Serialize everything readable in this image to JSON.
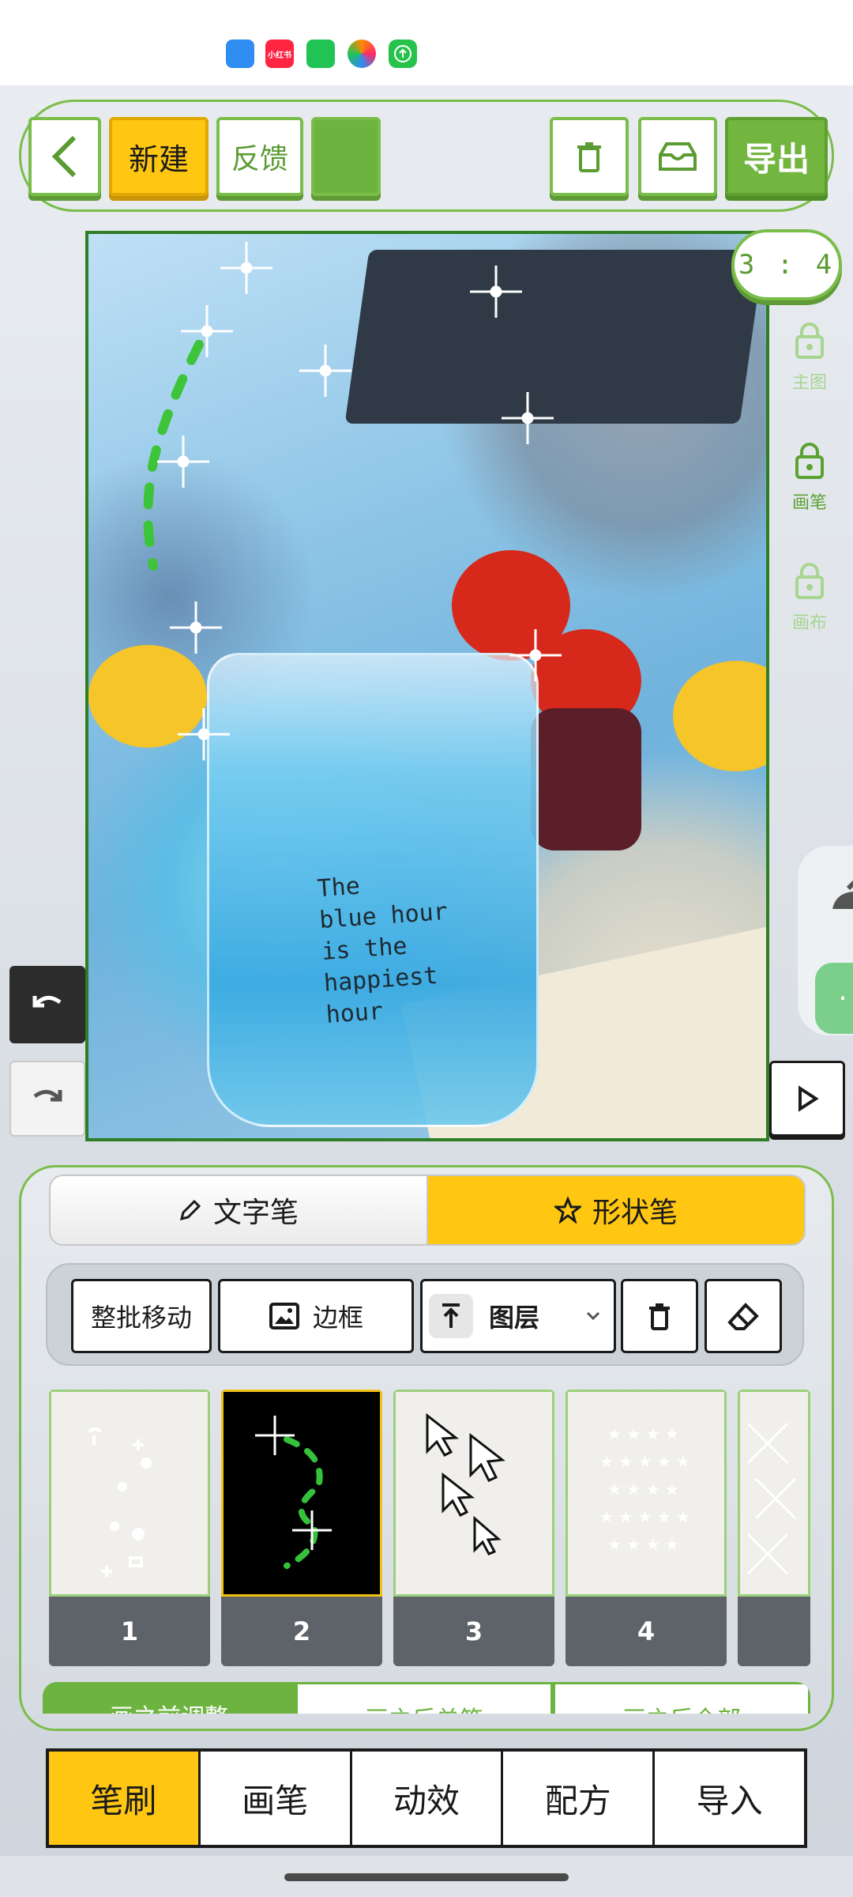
{
  "status_bar": {
    "apps": [
      {
        "name": "wallet",
        "color": "#2f8cf0",
        "label": ""
      },
      {
        "name": "xiaohongshu",
        "color": "#ff2442",
        "label": "小红书"
      },
      {
        "name": "app-green",
        "color": "#21c355",
        "label": ""
      },
      {
        "name": "app-colorful",
        "color": "#ff8a00",
        "label": ""
      },
      {
        "name": "app-upload",
        "color": "#27c24c",
        "label": ""
      }
    ]
  },
  "toolbar": {
    "back_icon": "chevron-left-icon",
    "new_label": "新建",
    "feedback_label": "反馈",
    "color_swatch": "#6db33f",
    "delete_icon": "trash-icon",
    "inbox_icon": "tray-icon",
    "export_label": "导出"
  },
  "canvas": {
    "ratio": "3 : 4",
    "cup_text": [
      "The",
      "blue hour",
      "is the",
      "happiest",
      "hour"
    ]
  },
  "side_panel": {
    "items": [
      {
        "label": "主图",
        "icon": "lock-icon",
        "active": false
      },
      {
        "label": "画笔",
        "icon": "lock-icon",
        "active": true
      },
      {
        "label": "画布",
        "icon": "lock-icon",
        "active": false
      }
    ]
  },
  "pen_tabs": {
    "text_pen": "文字笔",
    "shape_pen": "形状笔",
    "active": "shape_pen"
  },
  "tools": {
    "batch_move": "整批移动",
    "border": "边框",
    "layer": "图层"
  },
  "brush_cards": [
    {
      "number": "1"
    },
    {
      "number": "2",
      "selected": true
    },
    {
      "number": "3"
    },
    {
      "number": "4"
    },
    {
      "number": ""
    }
  ],
  "sub_tabs": [
    "画之前调整",
    "画之后单笔",
    "画之后全部"
  ],
  "bottom_nav": {
    "items": [
      "笔刷",
      "画笔",
      "动效",
      "配方",
      "导入"
    ],
    "active": 0
  },
  "colors": {
    "accent_green": "#7bbd4a",
    "accent_yellow": "#ffc712"
  }
}
